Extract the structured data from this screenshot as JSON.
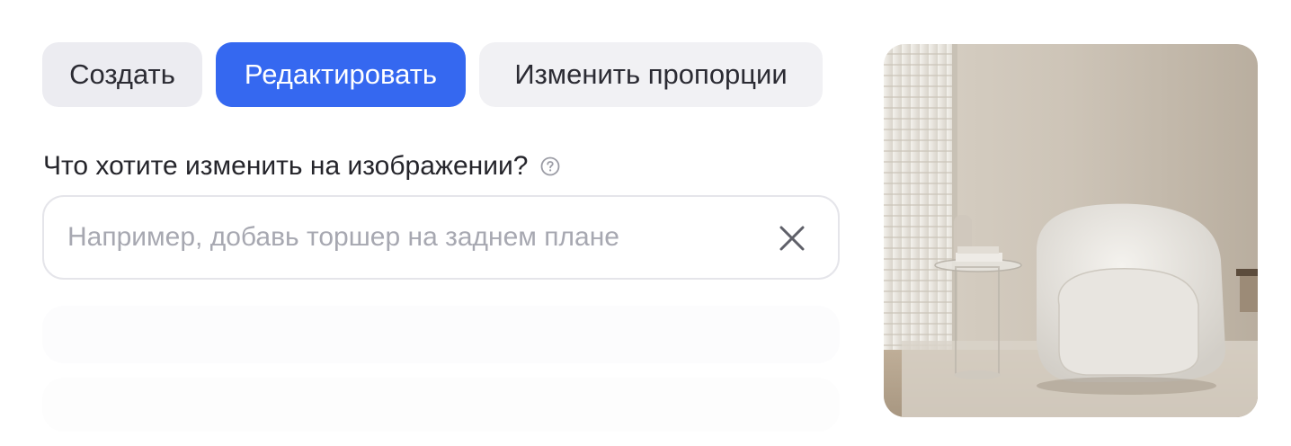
{
  "tabs": [
    {
      "label": "Создать",
      "active": false
    },
    {
      "label": "Редактировать",
      "active": true
    },
    {
      "label": "Изменить пропорции",
      "active": false
    }
  ],
  "prompt": {
    "label": "Что хотите изменить на изображении?",
    "placeholder": "Например, добавь торшер на заднем плане",
    "value": "",
    "help_icon": "question-circle-icon",
    "clear_icon": "close-icon"
  },
  "colors": {
    "accent": "#3568f0",
    "tab_bg": "#ececf1",
    "text": "#25252b",
    "placeholder": "#a7a8b1"
  },
  "preview": {
    "icon": "armchair-photo"
  }
}
